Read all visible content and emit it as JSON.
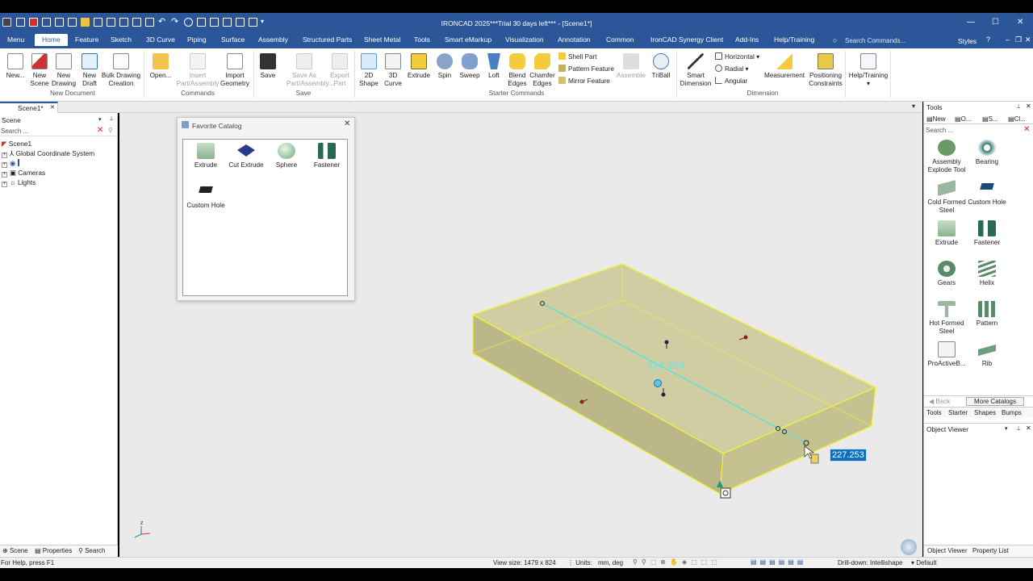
{
  "window": {
    "title": "IRONCAD 2025***Trial 30 days left*** - [Scene1*]",
    "minimize": "—",
    "maximize": "☐",
    "close": "✕"
  },
  "menu": {
    "tabs": [
      "Menu",
      "Home",
      "Feature",
      "Sketch",
      "3D Curve",
      "Piping",
      "Surface",
      "Assembly",
      "Structured Parts",
      "Sheet Metal",
      "Tools",
      "Smart eMarkup",
      "Visualization",
      "Annotation",
      "Common",
      "IronCAD Synergy Client",
      "Add-Ins",
      "Help/Training"
    ],
    "active": "Home",
    "search_placeholder": "Search Commands...",
    "styles": "Styles"
  },
  "ribbon": {
    "new_doc": {
      "new": "New...",
      "new_scene": "New\nScene",
      "new_drawing": "New\nDrawing",
      "new_draft": "New\nDraft",
      "bulk": "Bulk Drawing\nCreation",
      "group": "New Document"
    },
    "commands": {
      "open": "Open...",
      "insert": "Insert\nPart/Assembly",
      "import": "Import\nGeometry",
      "group": "Commands"
    },
    "save": {
      "save": "Save",
      "save_as": "Save As\nPart/Assembly...",
      "export": "Export\nPart",
      "group": "Save"
    },
    "starter": {
      "shape2d": "2D\nShape",
      "curve3d": "3D\nCurve",
      "extrude": "Extrude",
      "spin": "Spin",
      "sweep": "Sweep",
      "loft": "Loft",
      "blend": "Blend\nEdges",
      "chamfer": "Chamfer\nEdges",
      "shell": "Shell Part",
      "pattern": "Pattern Feature",
      "mirror": "Mirror Feature",
      "assemble": "Assemble",
      "triball": "TriBall",
      "group": "Starter Commands"
    },
    "dimension": {
      "smart": "Smart\nDimension",
      "horizontal": "Horizontal",
      "radial": "Radial",
      "angular": "Angular",
      "measurement": "Measurement",
      "positioning": "Positioning\nConstraints",
      "group": "Dimension"
    },
    "help": {
      "label": "Help/Training"
    }
  },
  "doc_tab": {
    "label": "Scene1*",
    "close": "✕"
  },
  "scene_panel": {
    "title": "Scene",
    "search_placeholder": "Search ...",
    "items": [
      "Scene1",
      "Global Coordinate System",
      "",
      "Cameras",
      "Lights"
    ],
    "tabs": [
      "Scene",
      "Properties",
      "Search"
    ]
  },
  "favorite_catalog": {
    "title": "Favorite Catalog",
    "close": "✕",
    "items": [
      "Extrude",
      "Cut Extrude",
      "Sphere",
      "Fastener",
      "Custom Hole"
    ]
  },
  "viewport": {
    "dimension_value": "227.253",
    "ghost_value": "227.253",
    "axis_label": "z"
  },
  "tools_panel": {
    "title": "Tools",
    "tabs_top": [
      "New",
      "O...",
      "S...",
      "Cl..."
    ],
    "search_placeholder": "Search ...",
    "items": [
      "Assembly\nExplode Tool",
      "Bearing",
      "Cold Formed\nSteel",
      "Custom Hole",
      "Extrude",
      "Fastener",
      "Gears",
      "Helix",
      "Hot Formed\nSteel",
      "Pattern",
      "ProActiveB...",
      "Rib"
    ],
    "back": "Back",
    "more": "More Catalogs",
    "tabs": [
      "Tools",
      "Starter",
      "Shapes",
      "Bumps"
    ]
  },
  "object_viewer": {
    "title": "Object Viewer",
    "tabs": [
      "Object Viewer",
      "Property List"
    ]
  },
  "status": {
    "help": "For Help, press F1",
    "view_size": "View size: 1479 x 824",
    "units_label": "Units:",
    "units": "mm, deg",
    "drilldown": "Drill-down: Intellishape",
    "style": "Default"
  },
  "colors": {
    "accent": "#2b579a",
    "part_fill": "#c8c391",
    "part_edge": "#f2f23a",
    "dim_line": "#5fe0d4",
    "value_bg": "#0e6fbf"
  }
}
